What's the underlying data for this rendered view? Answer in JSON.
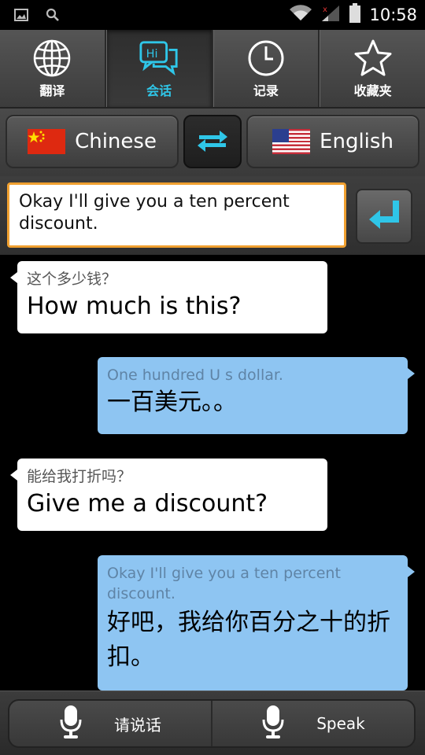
{
  "status_bar": {
    "time": "10:58",
    "icons": [
      "picture-icon",
      "search-icon",
      "wifi-icon",
      "signal-icon",
      "battery-icon"
    ]
  },
  "tabs": [
    {
      "label": "翻译",
      "icon": "globe-icon",
      "active": false
    },
    {
      "label": "会话",
      "icon": "chat-bubbles-icon",
      "active": true
    },
    {
      "label": "记录",
      "icon": "clock-icon",
      "active": false
    },
    {
      "label": "收藏夹",
      "icon": "star-icon",
      "active": false
    }
  ],
  "language_bar": {
    "source_language": "Chinese",
    "target_language": "English",
    "source_flag": "china-flag-icon",
    "target_flag": "usa-flag-icon",
    "swap_icon": "swap-arrows-icon"
  },
  "input": {
    "value": "Okay I'll give you a ten percent discount.",
    "send_icon": "enter-arrow-icon"
  },
  "conversation": [
    {
      "side": "left",
      "source": "这个多少钱？",
      "translation": "How much is this?"
    },
    {
      "side": "right",
      "source": "One hundred U s dollar.",
      "translation": "一百美元。。"
    },
    {
      "side": "left",
      "source": "能给我打折吗？",
      "translation": "Give me a discount?"
    },
    {
      "side": "right",
      "source": "Okay I'll give you a ten percent discount.",
      "translation": "好吧，我给你百分之十的折扣。"
    }
  ],
  "bottom_bar": {
    "speak_chinese_label": "请说话",
    "speak_english_label": "Speak",
    "mic_icon": "microphone-icon"
  },
  "colors": {
    "accent": "#2fc6e8",
    "input_border": "#f0a030",
    "bubble_left": "#ffffff",
    "bubble_right": "#8ec5f2"
  }
}
